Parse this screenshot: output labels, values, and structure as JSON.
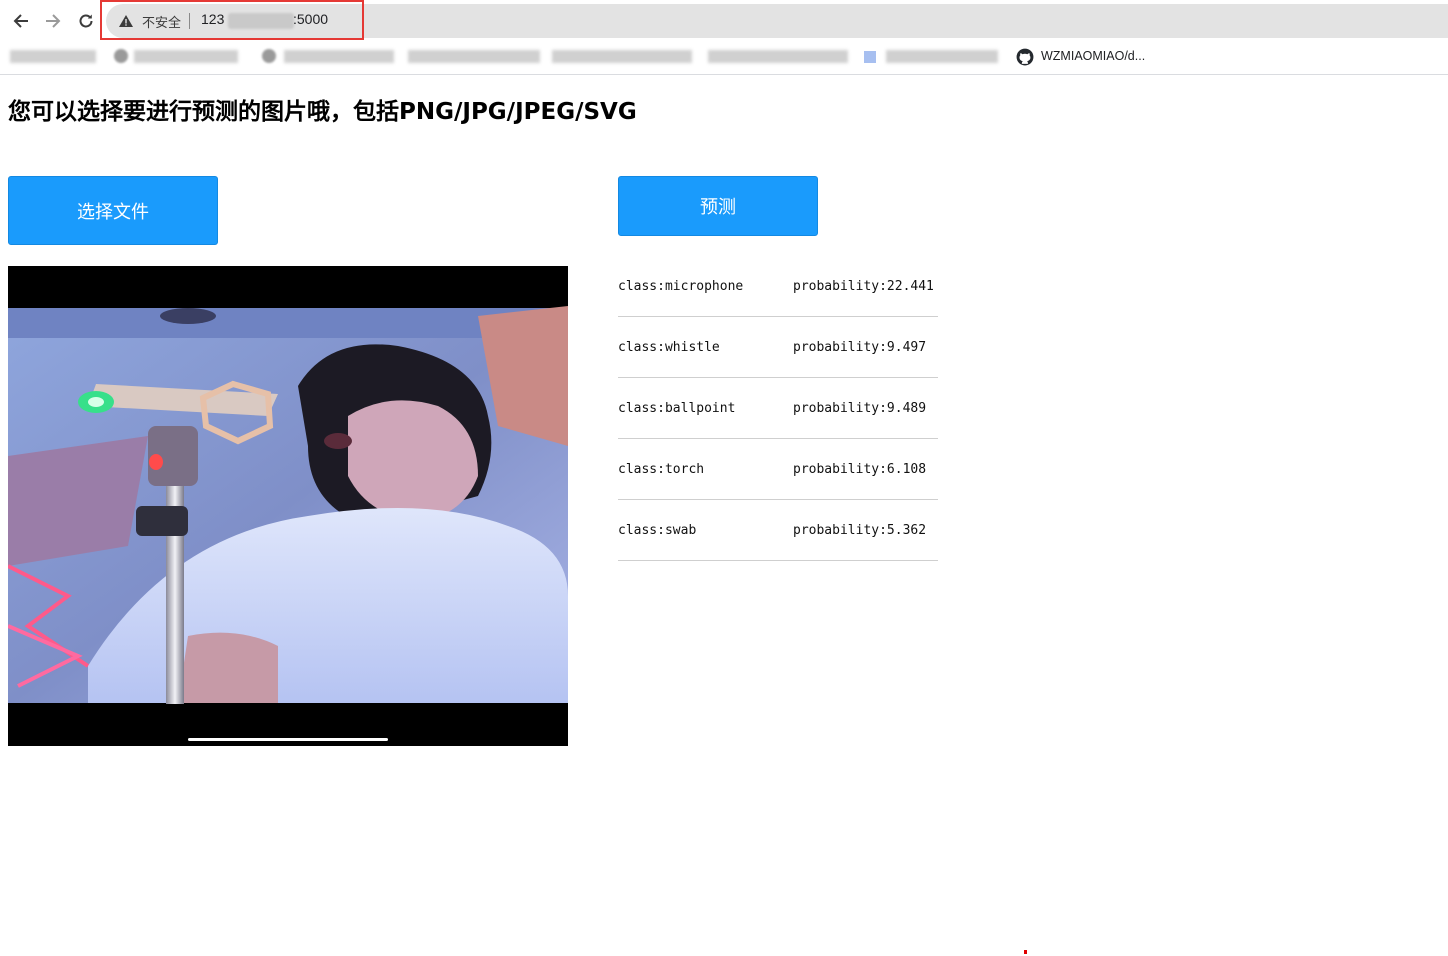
{
  "browser": {
    "security_label": "不安全",
    "url_prefix": "123",
    "url_suffix": ":5000",
    "bookmark_github_label": "WZMIAOMIAO/d..."
  },
  "page": {
    "heading": "您可以选择要进行预测的图片哦，包括PNG/JPG/JPEG/SVG",
    "choose_file_label": "选择文件",
    "predict_label": "预测"
  },
  "results": [
    {
      "class": "class:microphone",
      "probability": "probability:22.441"
    },
    {
      "class": "class:whistle",
      "probability": "probability:9.497"
    },
    {
      "class": "class:ballpoint",
      "probability": "probability:9.489"
    },
    {
      "class": "class:torch",
      "probability": "probability:6.108"
    },
    {
      "class": "class:swab",
      "probability": "probability:5.362"
    }
  ],
  "colors": {
    "button_blue": "#1a9bfc",
    "highlight_red": "#e53935"
  }
}
